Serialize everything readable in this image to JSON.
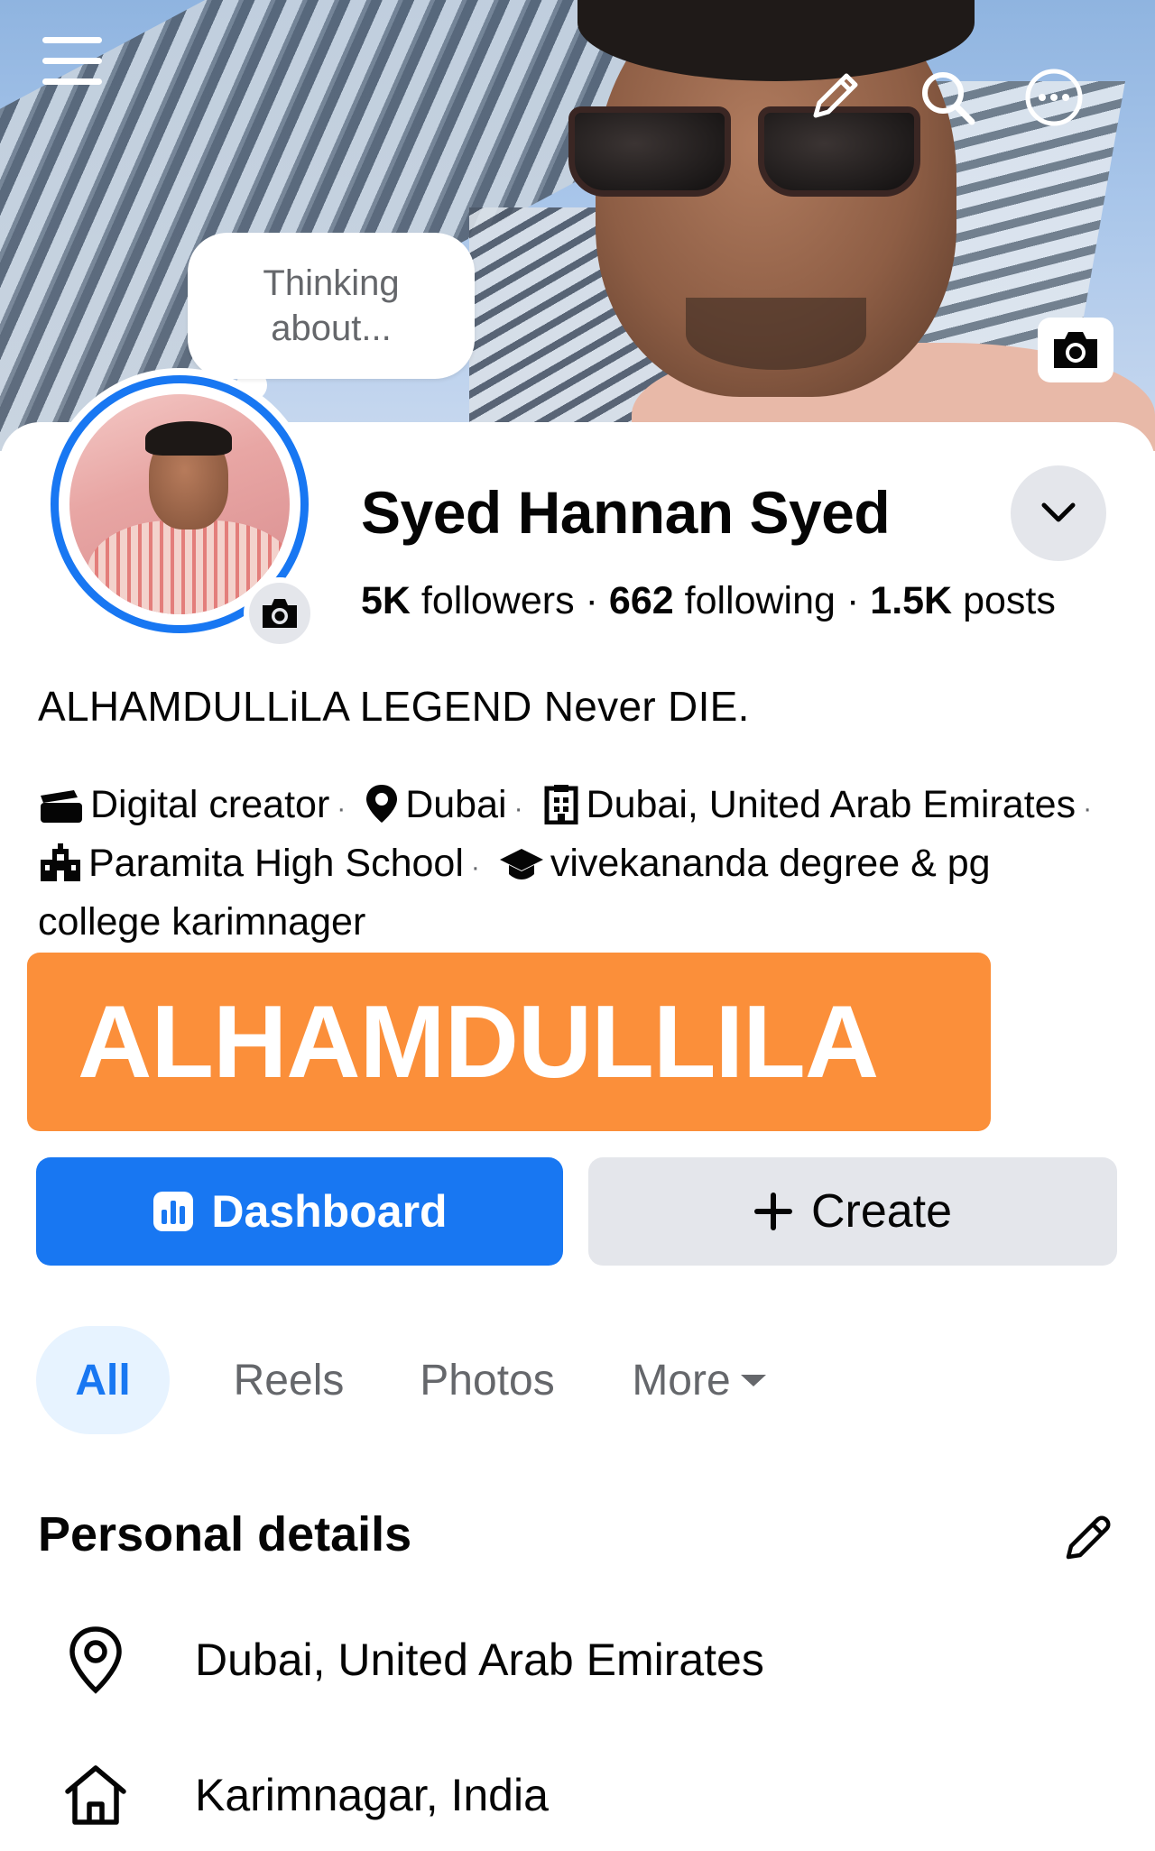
{
  "cover": {
    "thought_bubble": "Thinking about..."
  },
  "profile": {
    "name": "Syed Hannan Syed",
    "followers_count": "5K",
    "followers_label": "followers",
    "following_count": "662",
    "following_label": "following",
    "posts_count": "1.5K",
    "posts_label": "posts",
    "bio": "ALHAMDULLiLA LEGEND Never DIE."
  },
  "details_line": {
    "category": "Digital creator",
    "current_city": "Dubai",
    "workplace": "Dubai, United Arab Emirates",
    "high_school": "Paramita High School",
    "college": "vivekananda degree & pg college karimnager"
  },
  "banner": {
    "text": "ALHAMDULLILA",
    "color": "#fb8f3a"
  },
  "actions": {
    "dashboard_label": "Dashboard",
    "create_label": "Create",
    "primary_color": "#1877f2"
  },
  "tabs": [
    {
      "label": "All",
      "active": true
    },
    {
      "label": "Reels",
      "active": false
    },
    {
      "label": "Photos",
      "active": false
    },
    {
      "label": "More",
      "active": false
    }
  ],
  "personal_details": {
    "title": "Personal details",
    "items": [
      {
        "icon": "location-pin-icon",
        "text": "Dubai, United Arab Emirates"
      },
      {
        "icon": "home-icon",
        "text": "Karimnagar, India"
      }
    ]
  }
}
